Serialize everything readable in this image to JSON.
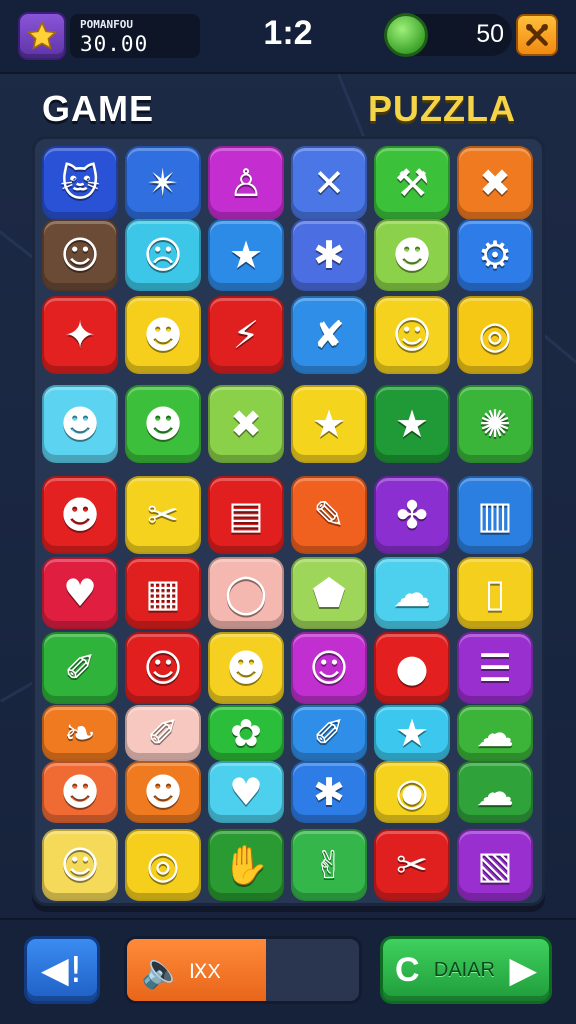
{
  "header": {
    "star_icon": "star-icon",
    "score_label": "POMANFOU",
    "score_value": "30.00",
    "timer": "1:2",
    "coins": "50",
    "coin_icon": "coin-icon",
    "settings_icon": "crossed-tools-icon"
  },
  "titles": {
    "left": "GAME",
    "right": "PUZZLA"
  },
  "board": {
    "rows": [
      [
        {
          "c": "#2a52d6",
          "g": "🐱"
        },
        {
          "c": "#2f6fe0",
          "g": "✴"
        },
        {
          "c": "#c42ed0",
          "g": "♙"
        },
        {
          "c": "#4a76e6",
          "g": "✕"
        },
        {
          "c": "#3cc23a",
          "g": "⚒"
        },
        {
          "c": "#f07a20",
          "g": "✖"
        }
      ],
      [
        {
          "c": "#6b4a36",
          "g": "☺"
        },
        {
          "c": "#3cc7e8",
          "g": "☹"
        },
        {
          "c": "#2d8be8",
          "g": "★"
        },
        {
          "c": "#4b6fe2",
          "g": "✱"
        },
        {
          "c": "#8bd24a",
          "g": "☻"
        },
        {
          "c": "#2e7ce8",
          "g": "⚙"
        }
      ],
      [
        {
          "c": "#e32121",
          "g": "✦"
        },
        {
          "c": "#f5cf1c",
          "g": "☻"
        },
        {
          "c": "#e01f1f",
          "g": "⚡"
        },
        {
          "c": "#2f8fe8",
          "g": "✘"
        },
        {
          "c": "#f5d21e",
          "g": "☺"
        },
        {
          "c": "#f5c816",
          "g": "◎"
        }
      ],
      [
        {
          "c": "#5cd3f0",
          "g": "☻"
        },
        {
          "c": "#3cbf3a",
          "g": "☻"
        },
        {
          "c": "#8ad048",
          "g": "✖"
        },
        {
          "c": "#f5d41e",
          "g": "★"
        },
        {
          "c": "#1f9a36",
          "g": "★"
        },
        {
          "c": "#3ab53a",
          "g": "✺"
        }
      ],
      [
        {
          "c": "#e32121",
          "g": "☻"
        },
        {
          "c": "#f5d21e",
          "g": "✂"
        },
        {
          "c": "#e21f1f",
          "g": "▤"
        },
        {
          "c": "#f0601e",
          "g": "✎"
        },
        {
          "c": "#8b2fd0",
          "g": "✤"
        },
        {
          "c": "#2b7fe0",
          "g": "▥"
        }
      ],
      [
        {
          "c": "#e01f40",
          "g": "♥"
        },
        {
          "c": "#e0201f",
          "g": "▦"
        },
        {
          "c": "#f4b8b0",
          "g": "◯"
        },
        {
          "c": "#9ed65a",
          "g": "⬟"
        },
        {
          "c": "#4dd0ee",
          "g": "☁"
        },
        {
          "c": "#f5cf1e",
          "g": "▯"
        }
      ],
      [
        {
          "c": "#2fb33a",
          "g": "✐"
        },
        {
          "c": "#e11f1f",
          "g": "☺"
        },
        {
          "c": "#f5d020",
          "g": "☻"
        },
        {
          "c": "#c22fd0",
          "g": "☺"
        },
        {
          "c": "#e31f1f",
          "g": "●"
        },
        {
          "c": "#9a2fd0",
          "g": "☰"
        }
      ],
      [
        {
          "c": "#f07a20",
          "g": "❧"
        },
        {
          "c": "#f7c8c0",
          "g": "✐"
        },
        {
          "c": "#2bbe3a",
          "g": "✿"
        },
        {
          "c": "#2f8fe8",
          "g": "✐"
        },
        {
          "c": "#3cc8ee",
          "g": "★"
        },
        {
          "c": "#3cb43a",
          "g": "☁"
        }
      ],
      [
        {
          "c": "#f06a34",
          "g": "☻"
        },
        {
          "c": "#f07a20",
          "g": "☻"
        },
        {
          "c": "#4dd0ee",
          "g": "♥"
        },
        {
          "c": "#2e7ce6",
          "g": "✱"
        },
        {
          "c": "#f5d21e",
          "g": "◉"
        },
        {
          "c": "#2fa23a",
          "g": "☁"
        }
      ],
      [
        {
          "c": "#f5da5a",
          "g": "☺"
        },
        {
          "c": "#f5cf1c",
          "g": "◎"
        },
        {
          "c": "#2a9a32",
          "g": "✋"
        },
        {
          "c": "#34b64a",
          "g": "✌"
        },
        {
          "c": "#e01f1f",
          "g": "✂"
        },
        {
          "c": "#9a2fd0",
          "g": "▧"
        }
      ]
    ]
  },
  "footer": {
    "back_icon": "back-arrow-icon",
    "back_label": "◀!",
    "volume_icon": "speaker-icon",
    "volume_label": "ⅨX",
    "volume_level": 0.6,
    "next_c": "C",
    "next_label": "DAIAR",
    "next_icon": "play-arrow-icon"
  }
}
